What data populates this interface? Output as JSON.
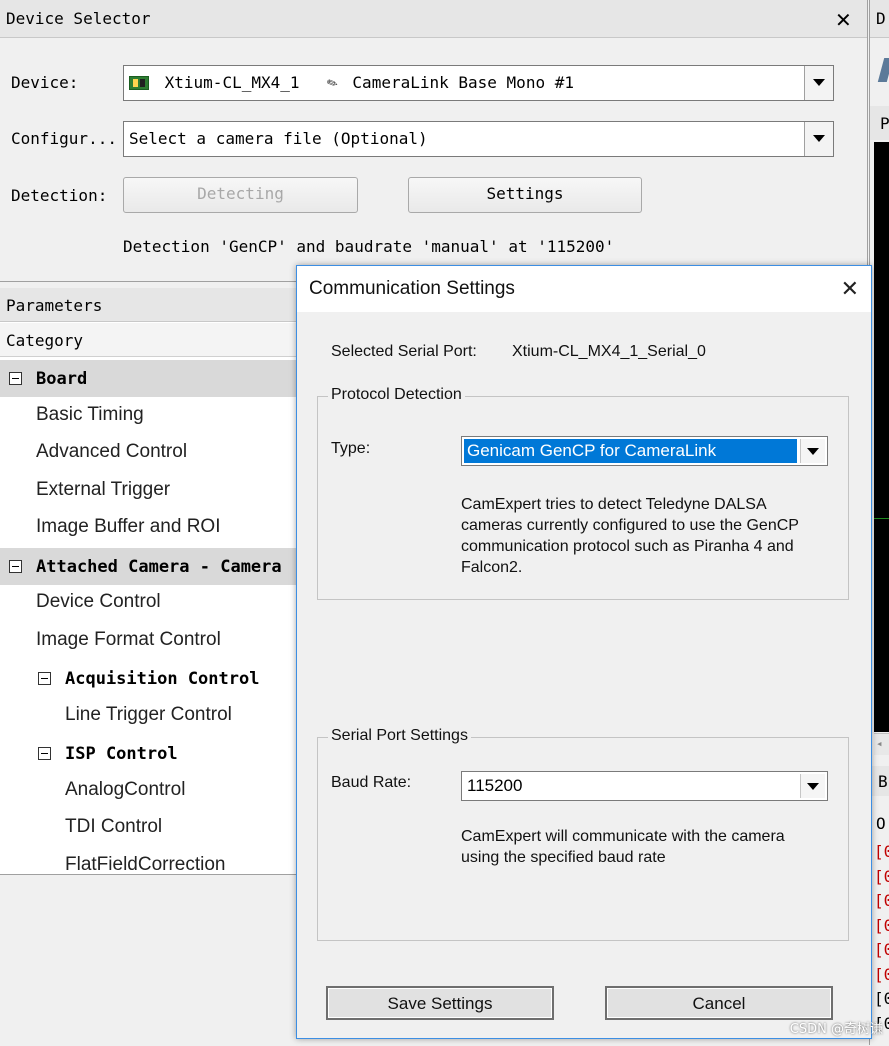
{
  "device_selector": {
    "title": "Device Selector",
    "close_glyph": "✕",
    "device_label": "Device:",
    "device_value": "Xtium-CL_MX4_1",
    "device_camera": "CameraLink Base Mono #1",
    "config_label": "Configur...",
    "config_value": "Select a camera file (Optional)",
    "detection_label": "Detection:",
    "detecting_button": "Detecting",
    "settings_button": "Settings",
    "detection_status": "Detection 'GenCP' and baudrate 'manual' at '115200'"
  },
  "parameters": {
    "title": "Parameters",
    "category_header": "Category",
    "rows": [
      {
        "label": "Board",
        "kind": "group"
      },
      {
        "label": "Basic Timing",
        "kind": "leaf"
      },
      {
        "label": "Advanced Control",
        "kind": "leaf"
      },
      {
        "label": "External Trigger",
        "kind": "leaf"
      },
      {
        "label": "Image Buffer and ROI",
        "kind": "leaf"
      },
      {
        "label": "Attached Camera - Camera",
        "kind": "group"
      },
      {
        "label": "Device Control",
        "kind": "leaf"
      },
      {
        "label": "Image Format Control",
        "kind": "leaf"
      },
      {
        "label": "Acquisition Control",
        "kind": "sub"
      },
      {
        "label": "Line Trigger Control",
        "kind": "subleaf"
      },
      {
        "label": "ISP Control",
        "kind": "sub"
      },
      {
        "label": "AnalogControl",
        "kind": "subleaf"
      },
      {
        "label": "TDI Control",
        "kind": "subleaf"
      },
      {
        "label": "FlatFieldCorrection",
        "kind": "subleaf"
      }
    ]
  },
  "right_edge": {
    "top_letter": "D",
    "p_letter": "P",
    "b_letter": "B",
    "o_letter": "O",
    "log_brackets": [
      "[0",
      "[0",
      "[0",
      "[0",
      "[0",
      "[0",
      "[0",
      "[0"
    ]
  },
  "dialog": {
    "title": "Communication Settings",
    "close_glyph": "✕",
    "serial_port_label": "Selected Serial Port:",
    "serial_port_value": "Xtium-CL_MX4_1_Serial_0",
    "protocol_group": "Protocol Detection",
    "type_label": "Type:",
    "type_value": "Genicam GenCP for CameraLink",
    "protocol_help": "CamExpert tries to detect Teledyne DALSA cameras currently configured to use the GenCP communication protocol such as Piranha 4 and Falcon2.",
    "serial_group": "Serial Port Settings",
    "baud_label": "Baud Rate:",
    "baud_value": "115200",
    "baud_help": "CamExpert will communicate with the camera using the specified baud rate",
    "save_button": "Save Settings",
    "cancel_button": "Cancel"
  },
  "watermark": "CSDN @奇树谦"
}
